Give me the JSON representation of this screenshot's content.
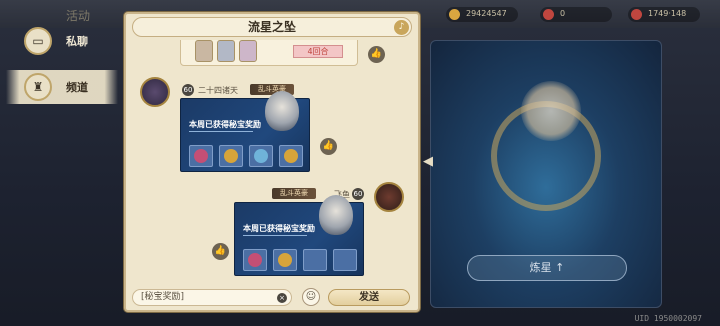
{
  "background": {
    "dim_title": "活动",
    "resources": [
      {
        "value": "29424547",
        "color": "#d9a640"
      },
      {
        "value": "0",
        "color": "#c0463f"
      },
      {
        "value": "1749·148",
        "color": "#c0463f"
      }
    ],
    "art_button": "炼星 ↑",
    "uid": "UID 1950002097"
  },
  "sidebar": {
    "items": [
      {
        "label": "私聊",
        "icon": "chat-bubble-icon"
      },
      {
        "label": "频道",
        "icon": "channel-icon"
      }
    ]
  },
  "panel": {
    "title": "流星之坠",
    "top_bubble": {
      "round_tag": "4回合"
    },
    "messages": [
      {
        "side": "left",
        "level": "60",
        "name": "二十四诸天",
        "tag": "乱斗英豪",
        "card_title": "本周已获得秘宝奖励",
        "items": [
          {
            "color": "#c44f75"
          },
          {
            "color": "#d7a43a"
          },
          {
            "color": "#6fb3d9"
          },
          {
            "color": "#d7a43a"
          }
        ]
      },
      {
        "side": "right",
        "level": "60",
        "name": "飞鱼",
        "tag": "乱斗英豪",
        "card_title": "本周已获得秘宝奖励",
        "items": [
          {
            "color": "#c44f75"
          },
          {
            "color": "#d7a43a"
          },
          {
            "color": null
          },
          {
            "color": null
          }
        ]
      }
    ],
    "input": {
      "value": "[秘宝奖励]"
    },
    "send_label": "发送"
  }
}
